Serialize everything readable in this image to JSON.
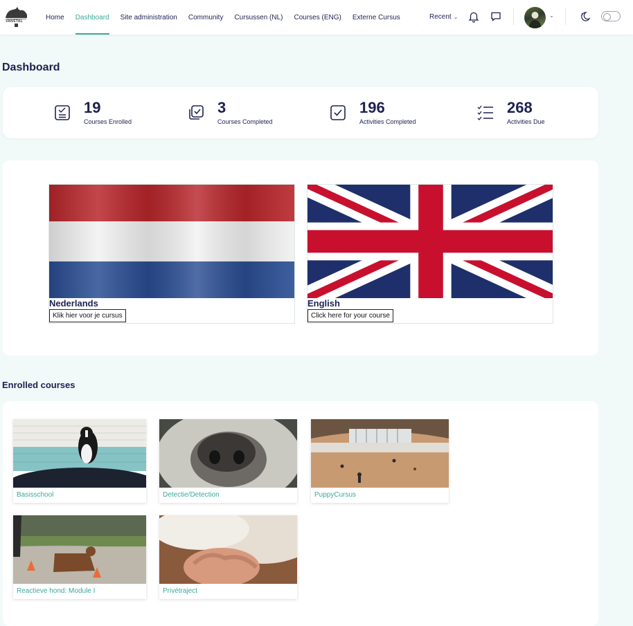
{
  "nav": {
    "logo_text": "VANSTAL",
    "links": [
      "Home",
      "Dashboard",
      "Site administration",
      "Community",
      "Cursussen (NL)",
      "Courses (ENG)",
      "Externe Cursus"
    ],
    "recent": "Recent"
  },
  "page_title": "Dashboard",
  "stats": [
    {
      "value": "19",
      "label": "Courses Enrolled",
      "icon": "clipboard-list-icon"
    },
    {
      "value": "3",
      "label": "Courses Completed",
      "icon": "stacked-checkbox-icon"
    },
    {
      "value": "196",
      "label": "Activities Completed",
      "icon": "checkbox-icon"
    },
    {
      "value": "268",
      "label": "Activities Due",
      "icon": "task-list-icon"
    }
  ],
  "languages": [
    {
      "name": "Nederlands",
      "button": "Klik hier voor je cursus"
    },
    {
      "name": "English",
      "button": "Click here for your course"
    }
  ],
  "enrolled_title": "Enrolled courses",
  "courses": [
    "Basisschool",
    "Detectie/Detection",
    "PuppyCursus",
    "Reactieve hond: Module I",
    "Privétraject"
  ],
  "colors": {
    "accent": "#3aa89a",
    "text": "#1d2050",
    "background": "#f2faf9"
  }
}
